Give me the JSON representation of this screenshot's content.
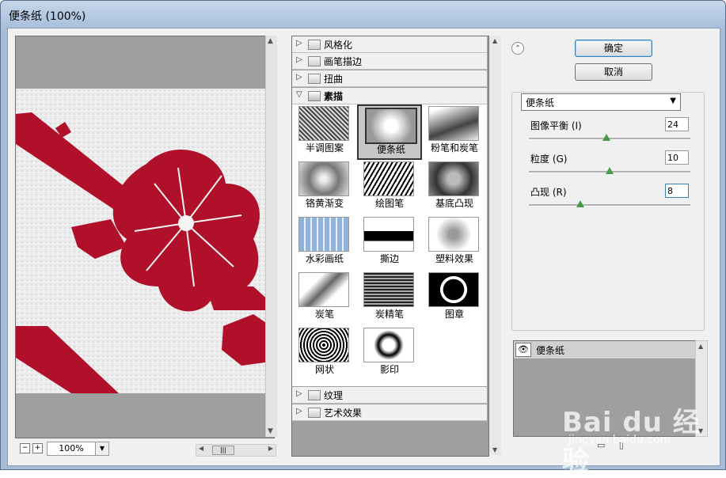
{
  "window": {
    "title": "便条纸 (100%)"
  },
  "preview": {
    "zoom": "100%",
    "minus": "−",
    "plus": "+"
  },
  "categories_top": [
    {
      "label": "风格化",
      "state": "collapsed"
    },
    {
      "label": "画笔描边",
      "state": "collapsed"
    },
    {
      "label": "扭曲",
      "state": "collapsed"
    },
    {
      "label": "素描",
      "state": "expanded"
    }
  ],
  "filters": [
    {
      "label": "半调图案"
    },
    {
      "label": "便条纸",
      "selected": true
    },
    {
      "label": "粉笔和炭笔"
    },
    {
      "label": "铬黄渐变"
    },
    {
      "label": "绘图笔"
    },
    {
      "label": "基底凸现"
    },
    {
      "label": "水彩画纸"
    },
    {
      "label": "撕边"
    },
    {
      "label": "塑料效果"
    },
    {
      "label": "炭笔"
    },
    {
      "label": "炭精笔"
    },
    {
      "label": "图章"
    },
    {
      "label": "网状"
    },
    {
      "label": "影印"
    }
  ],
  "categories_bottom": [
    {
      "label": "纹理",
      "state": "collapsed"
    },
    {
      "label": "艺术效果",
      "state": "collapsed"
    }
  ],
  "buttons": {
    "ok": "确定",
    "cancel": "取消"
  },
  "filter_select": {
    "value": "便条纸"
  },
  "params": [
    {
      "label": "图像平衡 (I)",
      "value": "24",
      "level": 0.48
    },
    {
      "label": "粒度 (G)",
      "value": "10",
      "level": 0.5
    },
    {
      "label": "凸现 (R)",
      "value": "8",
      "level": 0.32
    }
  ],
  "layers": [
    {
      "name": "便条纸"
    }
  ],
  "watermark": {
    "brand": "Bai du 经验",
    "url": "jingyan.baidu.com"
  },
  "colors": {
    "accent": "#3c7fb1",
    "flower": "#b0102a"
  }
}
